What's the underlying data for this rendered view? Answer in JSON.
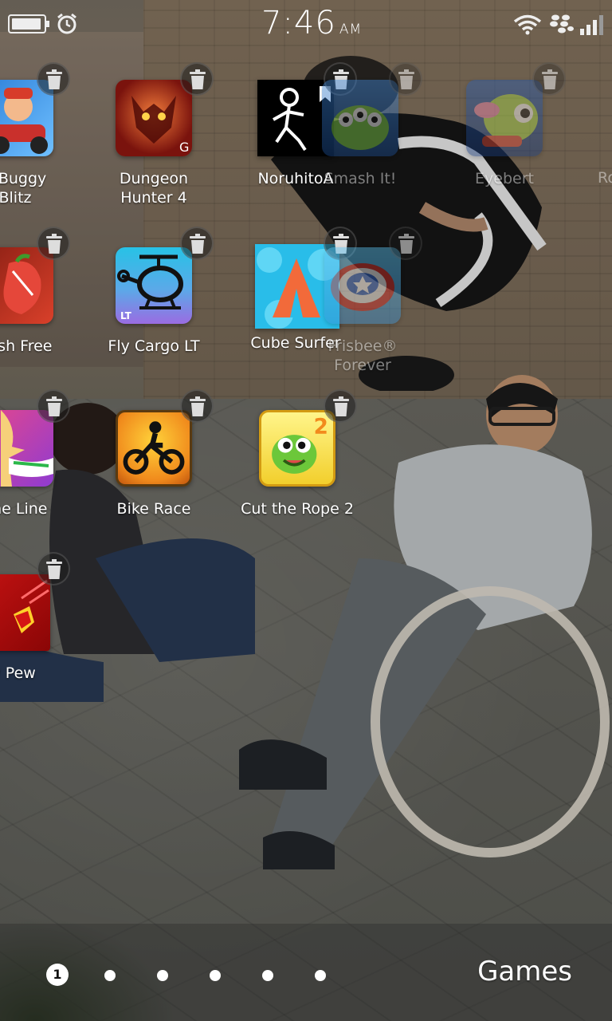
{
  "status_bar": {
    "time": "7:46",
    "ampm": "AM",
    "battery_level": 0.95,
    "icons": [
      "battery-icon",
      "alarm-icon",
      "wifi-icon",
      "blackberry-icon",
      "signal-icon"
    ]
  },
  "apps": [
    {
      "label": "n Buggy\nBlitz",
      "icon": "buggy-blitz-icon"
    },
    {
      "label": "Dungeon\nHunter 4",
      "icon": "dungeon-hunter-icon"
    },
    {
      "label": "NoruhitoA",
      "icon": "noruhito-icon"
    },
    {
      "label": "Smash It!",
      "icon": "smash-it-icon"
    },
    {
      "label": "Eyebert",
      "icon": "eyebert-icon"
    },
    {
      "label": "Ro",
      "icon": "partial-app-icon"
    },
    {
      "label": "Bash Free",
      "icon": "fruit-bash-icon"
    },
    {
      "label": "Fly Cargo LT",
      "icon": "fly-cargo-icon"
    },
    {
      "label": "Cube Surfer",
      "icon": "cube-surfer-icon"
    },
    {
      "label": "Frisbee®\nForever",
      "icon": "frisbee-icon"
    },
    {
      "label": "The Line",
      "icon": "the-line-icon"
    },
    {
      "label": "Bike Race",
      "icon": "bike-race-icon"
    },
    {
      "label": "Cut the Rope 2",
      "icon": "cut-the-rope-icon"
    },
    {
      "label": "w Pew",
      "icon": "pew-pew-icon"
    }
  ],
  "pager": {
    "active_page": "1",
    "page_count": 6
  },
  "folder": {
    "name": "Games"
  }
}
